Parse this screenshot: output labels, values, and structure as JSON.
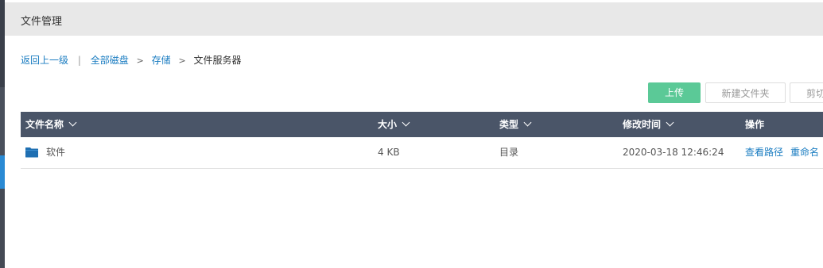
{
  "header": {
    "title": "文件管理"
  },
  "breadcrumb": {
    "back": "返回上一级",
    "sep": "|",
    "items": [
      "全部磁盘",
      "存储",
      "文件服务器"
    ],
    "arrow": ">"
  },
  "toolbar": {
    "upload": "上传",
    "new_folder": "新建文件夹",
    "cut": "剪切"
  },
  "table": {
    "columns": [
      "文件名称",
      "大小",
      "类型",
      "修改时间",
      "操作"
    ],
    "rows": [
      {
        "name": "软件",
        "size": "4 KB",
        "type": "目录",
        "modified": "2020-03-18 12:46:24",
        "actions": [
          "查看路径",
          "重命名"
        ]
      }
    ]
  },
  "colors": {
    "accent_green": "#5bc997",
    "header_bg": "#4a5568",
    "link": "#1a7cc1",
    "folder": "#1f6fb2"
  }
}
